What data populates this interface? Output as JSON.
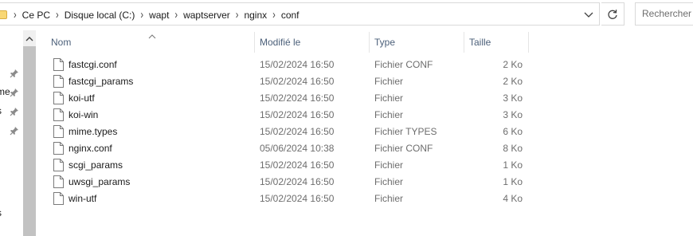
{
  "address": {
    "breadcrumbs": [
      "Ce PC",
      "Disque local (C:)",
      "wapt",
      "waptserver",
      "nginx",
      "conf"
    ]
  },
  "search": {
    "placeholder": "Rechercher dans"
  },
  "nav": {
    "fragments": [
      "me",
      "s",
      "s"
    ]
  },
  "columns": {
    "name": "Nom",
    "date": "Modifié le",
    "type": "Type",
    "size": "Taille"
  },
  "files": [
    {
      "name": "fastcgi.conf",
      "date": "15/02/2024 16:50",
      "type": "Fichier CONF",
      "size": "2 Ko"
    },
    {
      "name": "fastcgi_params",
      "date": "15/02/2024 16:50",
      "type": "Fichier",
      "size": "2 Ko"
    },
    {
      "name": "koi-utf",
      "date": "15/02/2024 16:50",
      "type": "Fichier",
      "size": "3 Ko"
    },
    {
      "name": "koi-win",
      "date": "15/02/2024 16:50",
      "type": "Fichier",
      "size": "3 Ko"
    },
    {
      "name": "mime.types",
      "date": "15/02/2024 16:50",
      "type": "Fichier TYPES",
      "size": "6 Ko"
    },
    {
      "name": "nginx.conf",
      "date": "05/06/2024 10:38",
      "type": "Fichier CONF",
      "size": "8 Ko"
    },
    {
      "name": "scgi_params",
      "date": "15/02/2024 16:50",
      "type": "Fichier",
      "size": "1 Ko"
    },
    {
      "name": "uwsgi_params",
      "date": "15/02/2024 16:50",
      "type": "Fichier",
      "size": "1 Ko"
    },
    {
      "name": "win-utf",
      "date": "15/02/2024 16:50",
      "type": "Fichier",
      "size": "4 Ko"
    }
  ]
}
